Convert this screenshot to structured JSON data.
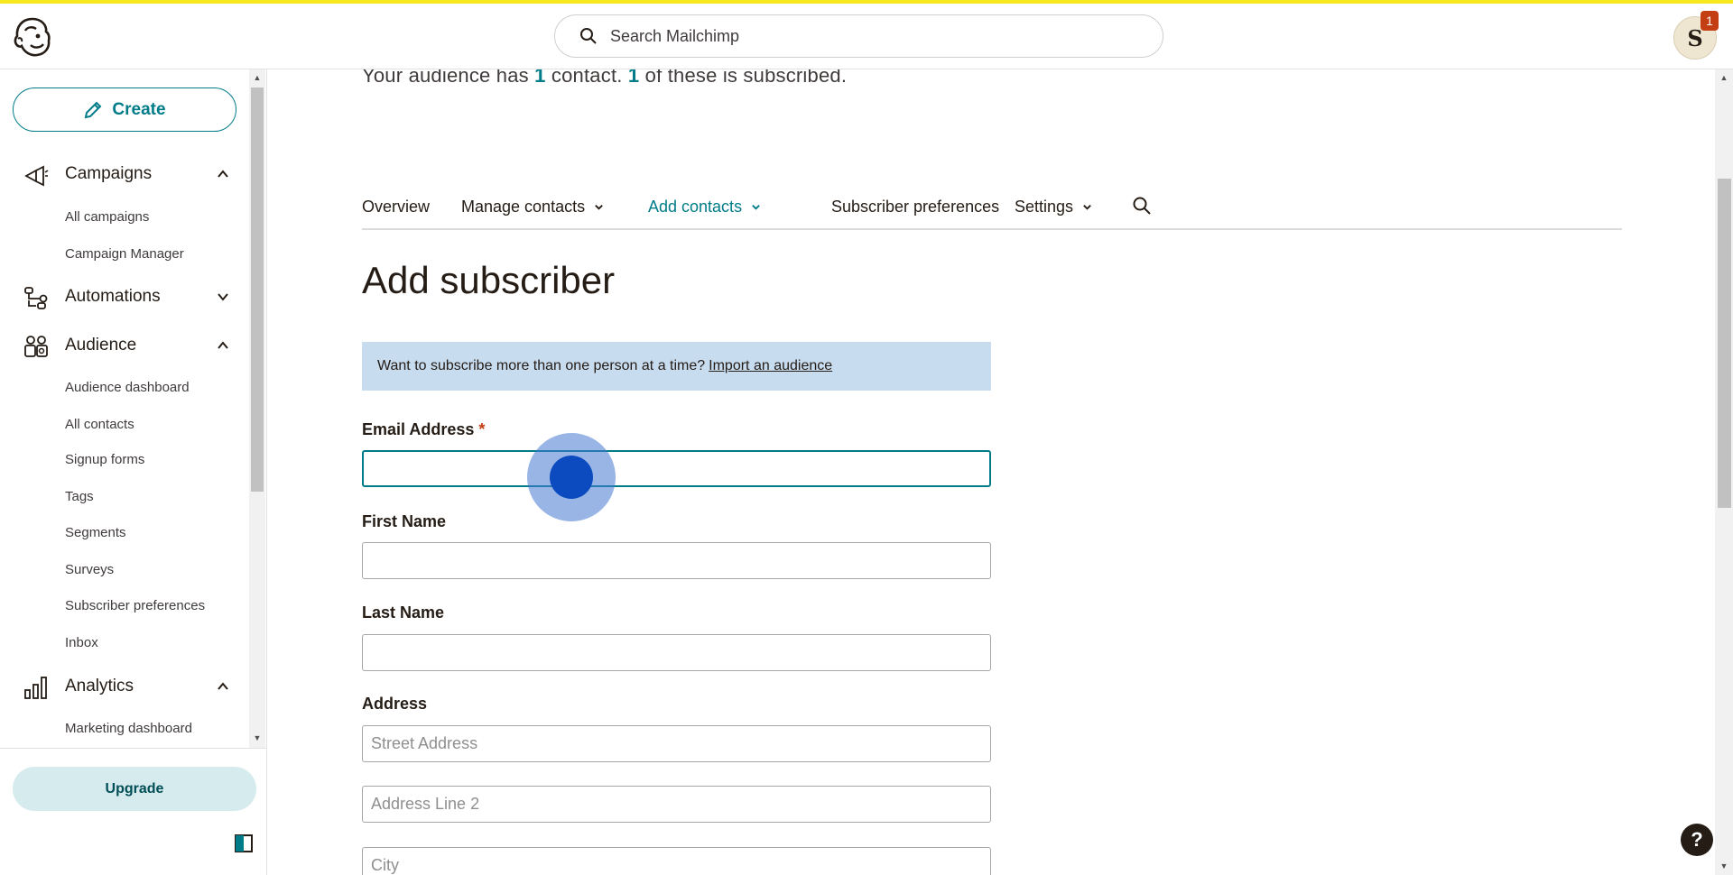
{
  "header": {
    "search_placeholder": "Search Mailchimp",
    "avatar_initial": "S",
    "notification_count": "1"
  },
  "sidebar": {
    "create_label": "Create",
    "sections": [
      {
        "label": "Campaigns",
        "icon": "megaphone-icon",
        "expanded": true,
        "items": [
          "All campaigns",
          "Campaign Manager"
        ]
      },
      {
        "label": "Automations",
        "icon": "automation-icon",
        "expanded": false,
        "items": []
      },
      {
        "label": "Audience",
        "icon": "audience-icon",
        "expanded": true,
        "items": [
          "Audience dashboard",
          "All contacts",
          "Signup forms",
          "Tags",
          "Segments",
          "Surveys",
          "Subscriber preferences",
          "Inbox"
        ]
      },
      {
        "label": "Analytics",
        "icon": "bar-chart-icon",
        "expanded": true,
        "items": [
          "Marketing dashboard"
        ]
      }
    ],
    "upgrade_label": "Upgrade"
  },
  "main": {
    "summary": {
      "pre": "Your audience has",
      "contacts": "1",
      "mid": "contact.",
      "subscribed": "1",
      "post": "of these is subscribed."
    },
    "tabs": [
      {
        "label": "Overview",
        "dropdown": false,
        "active": false
      },
      {
        "label": "Manage contacts",
        "dropdown": true,
        "active": false
      },
      {
        "label": "Add contacts",
        "dropdown": true,
        "active": true
      },
      {
        "label": "Subscriber preferences",
        "dropdown": false,
        "active": false
      },
      {
        "label": "Settings",
        "dropdown": true,
        "active": false
      }
    ],
    "title": "Add subscriber",
    "notice": {
      "text": "Want to subscribe more than one person at a time?",
      "link": "Import an audience"
    },
    "form": {
      "email_label": "Email Address",
      "required_mark": "*",
      "email_value": "",
      "first_name_label": "First Name",
      "last_name_label": "Last Name",
      "address_label": "Address",
      "street_placeholder": "Street Address",
      "line2_placeholder": "Address Line 2",
      "city_placeholder": "City"
    },
    "help_label": "?"
  },
  "colors": {
    "accent": "#007c89",
    "brand_yellow": "#f8e71c",
    "notice_bg": "#c8dcf0",
    "required": "#c33e12",
    "click_indicator": "#0b4bbf"
  }
}
